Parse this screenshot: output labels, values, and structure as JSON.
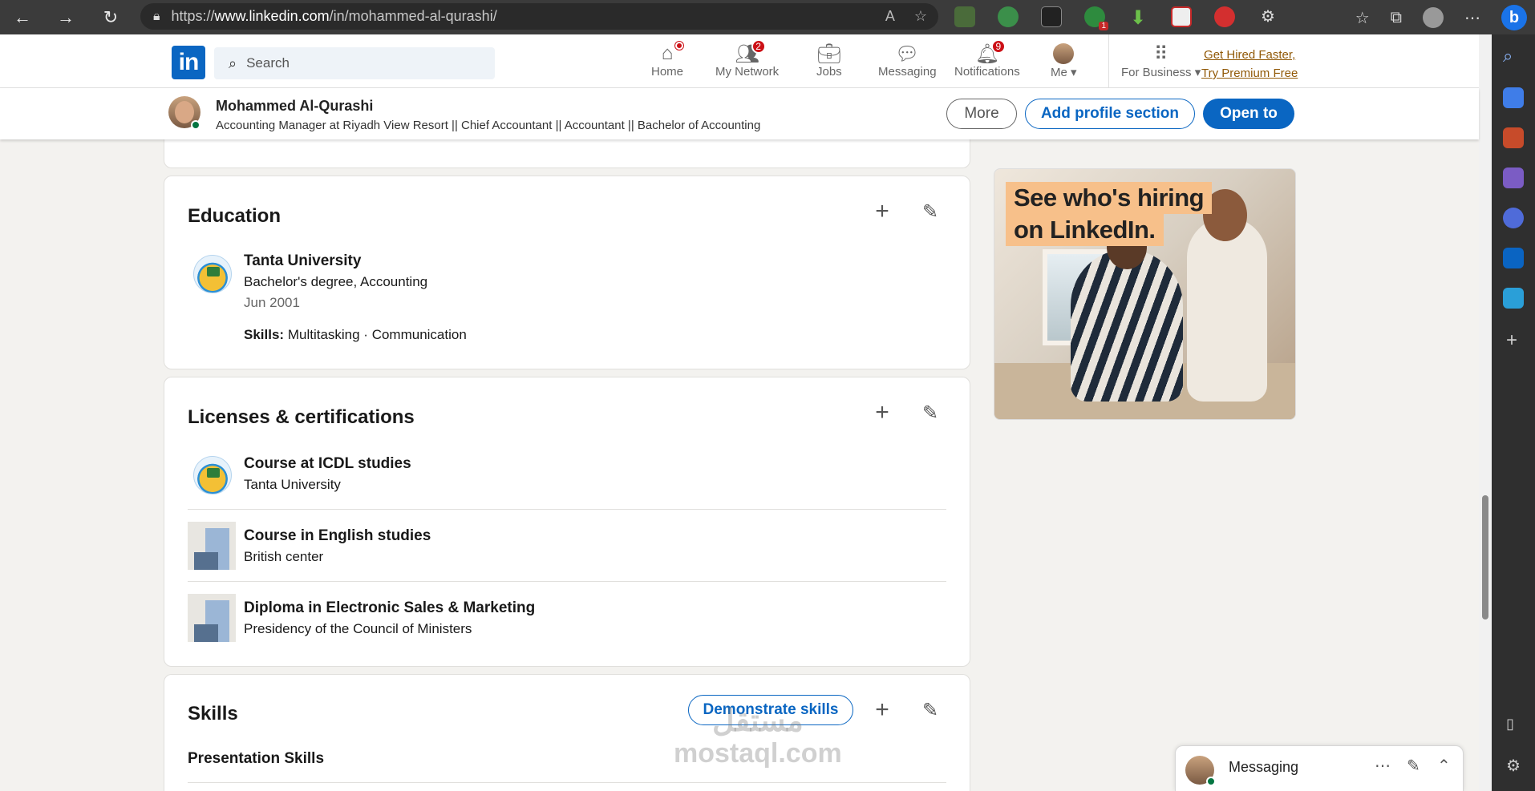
{
  "browser": {
    "url_prefix": "https://",
    "url_host": "www.linkedin.com",
    "url_path": "/in/mohammed-al-qurashi/",
    "ext_badge": "1"
  },
  "header": {
    "logo": "in",
    "search_placeholder": "Search",
    "nav": [
      {
        "label": "Home",
        "icon": "home-icon"
      },
      {
        "label": "My Network",
        "icon": "network-icon",
        "badge": "2"
      },
      {
        "label": "Jobs",
        "icon": "briefcase-icon"
      },
      {
        "label": "Messaging",
        "icon": "chat-icon"
      },
      {
        "label": "Notifications",
        "icon": "bell-icon",
        "badge": "9"
      },
      {
        "label": "Me",
        "icon": "avatar"
      },
      {
        "label": "For Business",
        "icon": "grid-icon"
      }
    ],
    "premium_line1": "Get Hired Faster,",
    "premium_line2": "Try Premium Free"
  },
  "profile_bar": {
    "name": "Mohammed Al-Qurashi",
    "headline": "Accounting Manager at Riyadh View Resort || Chief Accountant || Accountant || Bachelor of Accounting",
    "more_label": "More",
    "add_section_label": "Add profile section",
    "open_to_label": "Open to"
  },
  "education": {
    "title": "Education",
    "school": "Tanta University",
    "degree": "Bachelor's degree, Accounting",
    "date": "Jun 2001",
    "skills_label": "Skills:",
    "skills": "Multitasking · Communication"
  },
  "licenses": {
    "title": "Licenses & certifications",
    "items": [
      {
        "name": "Course at ICDL studies",
        "issuer": "Tanta University"
      },
      {
        "name": "Course in English studies",
        "issuer": "British center"
      },
      {
        "name": "Diploma in Electronic Sales & Marketing",
        "issuer": "Presidency of the Council of Ministers"
      }
    ]
  },
  "skills": {
    "title": "Skills",
    "demonstrate_label": "Demonstrate skills",
    "first_skill": "Presentation Skills"
  },
  "ad": {
    "line1": "See who's hiring",
    "line2": "on LinkedIn."
  },
  "messaging": {
    "title": "Messaging"
  },
  "watermark": {
    "line1": "مستقل",
    "line2": "mostaql.com"
  }
}
